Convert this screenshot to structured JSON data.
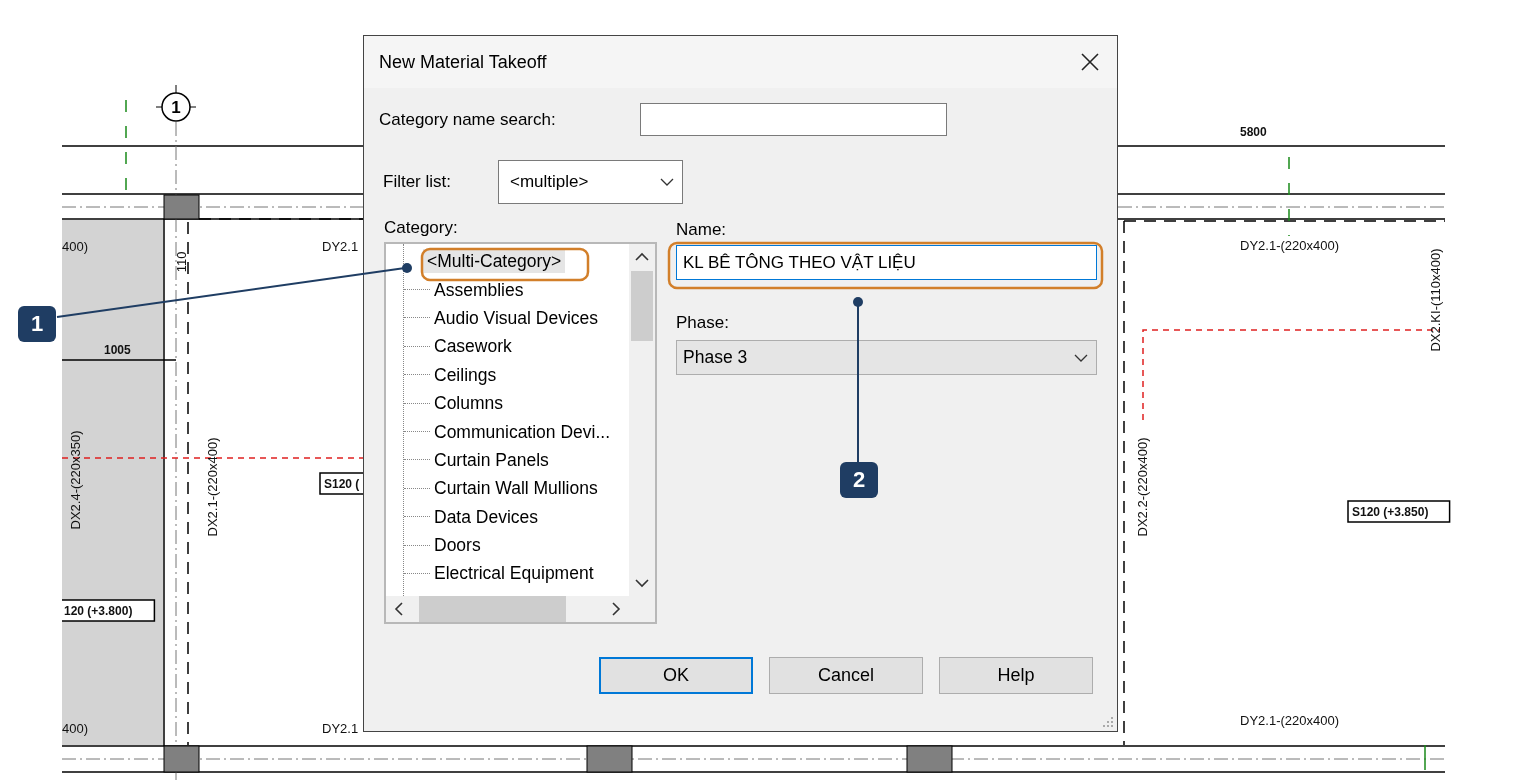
{
  "drawing": {
    "grid_bubble": "1",
    "labels": [
      {
        "text": "400)",
        "kind": "plain"
      },
      {
        "text": "DY2.1",
        "kind": "plain"
      },
      {
        "text": "110",
        "kind": "vertical"
      },
      {
        "text": "1005",
        "kind": "dimension"
      },
      {
        "text": "DX2.4-(220x350)",
        "kind": "vertical"
      },
      {
        "text": "DX2.1-(220x400)",
        "kind": "vertical"
      },
      {
        "text": "S120 (",
        "kind": "boxed"
      },
      {
        "text": "120 (+3.800)",
        "kind": "boxed"
      },
      {
        "text": "400)",
        "kind": "plain"
      },
      {
        "text": "DY2.1",
        "kind": "plain"
      },
      {
        "text": "5800",
        "kind": "dimension"
      },
      {
        "text": "DY2.1-(220x400)",
        "kind": "plain"
      },
      {
        "text": "DX2.KI-(110x400)",
        "kind": "vertical"
      },
      {
        "text": "DX2.2-(220x400)",
        "kind": "vertical"
      },
      {
        "text": "S120 (+3.850)",
        "kind": "boxed"
      },
      {
        "text": "DY2.1-(220x400)",
        "kind": "plain"
      }
    ]
  },
  "dialog": {
    "title": "New Material Takeoff",
    "search": {
      "label": "Category name search:"
    },
    "filter": {
      "label": "Filter list:",
      "value": "<multiple>"
    },
    "category": {
      "label": "Category:",
      "items": [
        {
          "label": "<Multi-Category>",
          "selected": true
        },
        {
          "label": "Assemblies",
          "selected": false
        },
        {
          "label": "Audio Visual Devices",
          "selected": false
        },
        {
          "label": "Casework",
          "selected": false
        },
        {
          "label": "Ceilings",
          "selected": false
        },
        {
          "label": "Columns",
          "selected": false
        },
        {
          "label": "Communication Devi...",
          "selected": false
        },
        {
          "label": "Curtain Panels",
          "selected": false
        },
        {
          "label": "Curtain Wall Mullions",
          "selected": false
        },
        {
          "label": "Data Devices",
          "selected": false
        },
        {
          "label": "Doors",
          "selected": false
        },
        {
          "label": "Electrical Equipment",
          "selected": false
        }
      ]
    },
    "name": {
      "label": "Name:",
      "value": "KL BÊ TÔNG THEO VẬT LIỆU"
    },
    "phase": {
      "label": "Phase:",
      "value": "Phase 3"
    },
    "buttons": [
      {
        "label": "OK",
        "default": true
      },
      {
        "label": "Cancel",
        "default": false
      },
      {
        "label": "Help",
        "default": false
      }
    ]
  },
  "callouts": [
    {
      "label": "1"
    },
    {
      "label": "2"
    }
  ]
}
